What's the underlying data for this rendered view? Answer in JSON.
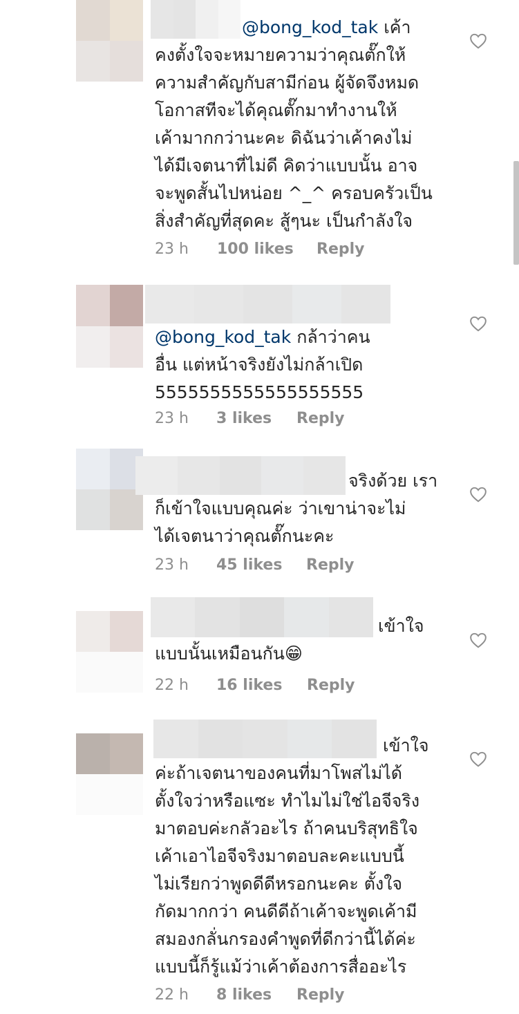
{
  "comments": [
    {
      "mention": "@bong_kod_tak",
      "lines": [
        "เค้า",
        "คงตั้งใจจะหมายความว่าคุณตั๊กให้",
        "ความสำคัญกับสามีก่อน ผู้จัดจึงหมด",
        "โอกาสทีจะได้คุณตั๊กมาทำงานให้",
        "เค้ามากกว่านะคะ ดิฉันว่าเค้าคงไม่",
        "ได้มีเจตนาที่ไม่ดี คิดว่าแบบนั้น อาจ",
        "จะพูดสั้นไปหน่อย ^_^ ครอบครัวเป็น",
        "สิ่งสำคัญที่สุดคะ สู้ๆนะ เป็นกำลังใจ"
      ],
      "time": "23 h",
      "likes": "100 likes",
      "reply": "Reply",
      "avatar_colors": [
        "#e1d9d2",
        "#ebe2d5",
        "#e8e4e2",
        "#e5dedb"
      ],
      "blur_colors": [
        "#e6e6e6",
        "#e4e4e4",
        "#f0f0f0",
        "#f6f6f6"
      ]
    },
    {
      "mention": "@bong_kod_tak",
      "lines": [
        "กล้าว่าคน",
        "อื่น แต่หน้าจริงยังไม่กล้าเปิด",
        "5555555555555555555"
      ],
      "time": "23 h",
      "likes": "3 likes",
      "reply": "Reply",
      "avatar_colors": [
        "#e2d4d2",
        "#c3aaa6",
        "#f1eeee",
        "#ebe2e1"
      ],
      "blur_colors": [
        "#e9e9e9",
        "#e7e7e7",
        "#e4e4e4",
        "#e8eaeb",
        "#e5e5e5"
      ]
    },
    {
      "mention": "",
      "lines": [
        "จริงด้วย เรา",
        "ก็เข้าใจแบบคุณค่ะ ว่าเขาน่าจะไม่",
        "ได้เจตนาว่าคุณตั๊กนะคะ"
      ],
      "time": "23 h",
      "likes": "45 likes",
      "reply": "Reply",
      "avatar_colors": [
        "#eaedf2",
        "#dcdfe6",
        "#e0e1e1",
        "#d8d3cf"
      ],
      "blur_colors": [
        "#ececec",
        "#e7e7e7",
        "#e3e3e3",
        "#e8e9ea",
        "#e6e6e6"
      ]
    },
    {
      "mention": "",
      "lines": [
        "เข้าใจ",
        "แบบนั้นเหมือนกัน😁"
      ],
      "time": "22 h",
      "likes": "16 likes",
      "reply": "Reply",
      "avatar_colors": [
        "#efebe9",
        "#e5d9d6",
        "#fafafa",
        "#fafafa"
      ],
      "blur_colors": [
        "#e9e9e9",
        "#e3e3e3",
        "#dedede",
        "#e6e8e9",
        "#e4e4e4"
      ]
    },
    {
      "mention": "",
      "lines": [
        "เข้าใจ",
        "ค่ะถ้าเจตนาของคนที่มาโพสไม่ได้",
        "ตั้งใจว่าหรือแซะ ทำไมไม่ใช่ไอจีจริง",
        "มาตอบค่ะกลัวอะไร ถ้าคนบริสุทธิใจ",
        "เค้าเอาไอจีจริงมาตอบละคะแบบนี้",
        "ไม่เรียกว่าพูดดีดีหรอกนะคะ ตั้งใจ",
        "กัดมากกว่า คนดีดีถ้าเค้าจะพูดเค้ามี",
        "สมองกลั่นกรองคำพูดที่ดีกว่านี้ได้ค่ะ",
        "แบบนี้ก็รู้แม้ว่าเค้าต้องการสื่ออะไร"
      ],
      "time": "22 h",
      "likes": "8 likes",
      "reply": "Reply",
      "avatar_colors": [
        "#bab1ab",
        "#c4b8b1",
        "#fbfbfb",
        "#fbfbfb"
      ],
      "blur_colors": [
        "#e7e7e7",
        "#e2e2e2",
        "#e4e4e4",
        "#e6e8e9",
        "#e3e3e3"
      ]
    }
  ]
}
